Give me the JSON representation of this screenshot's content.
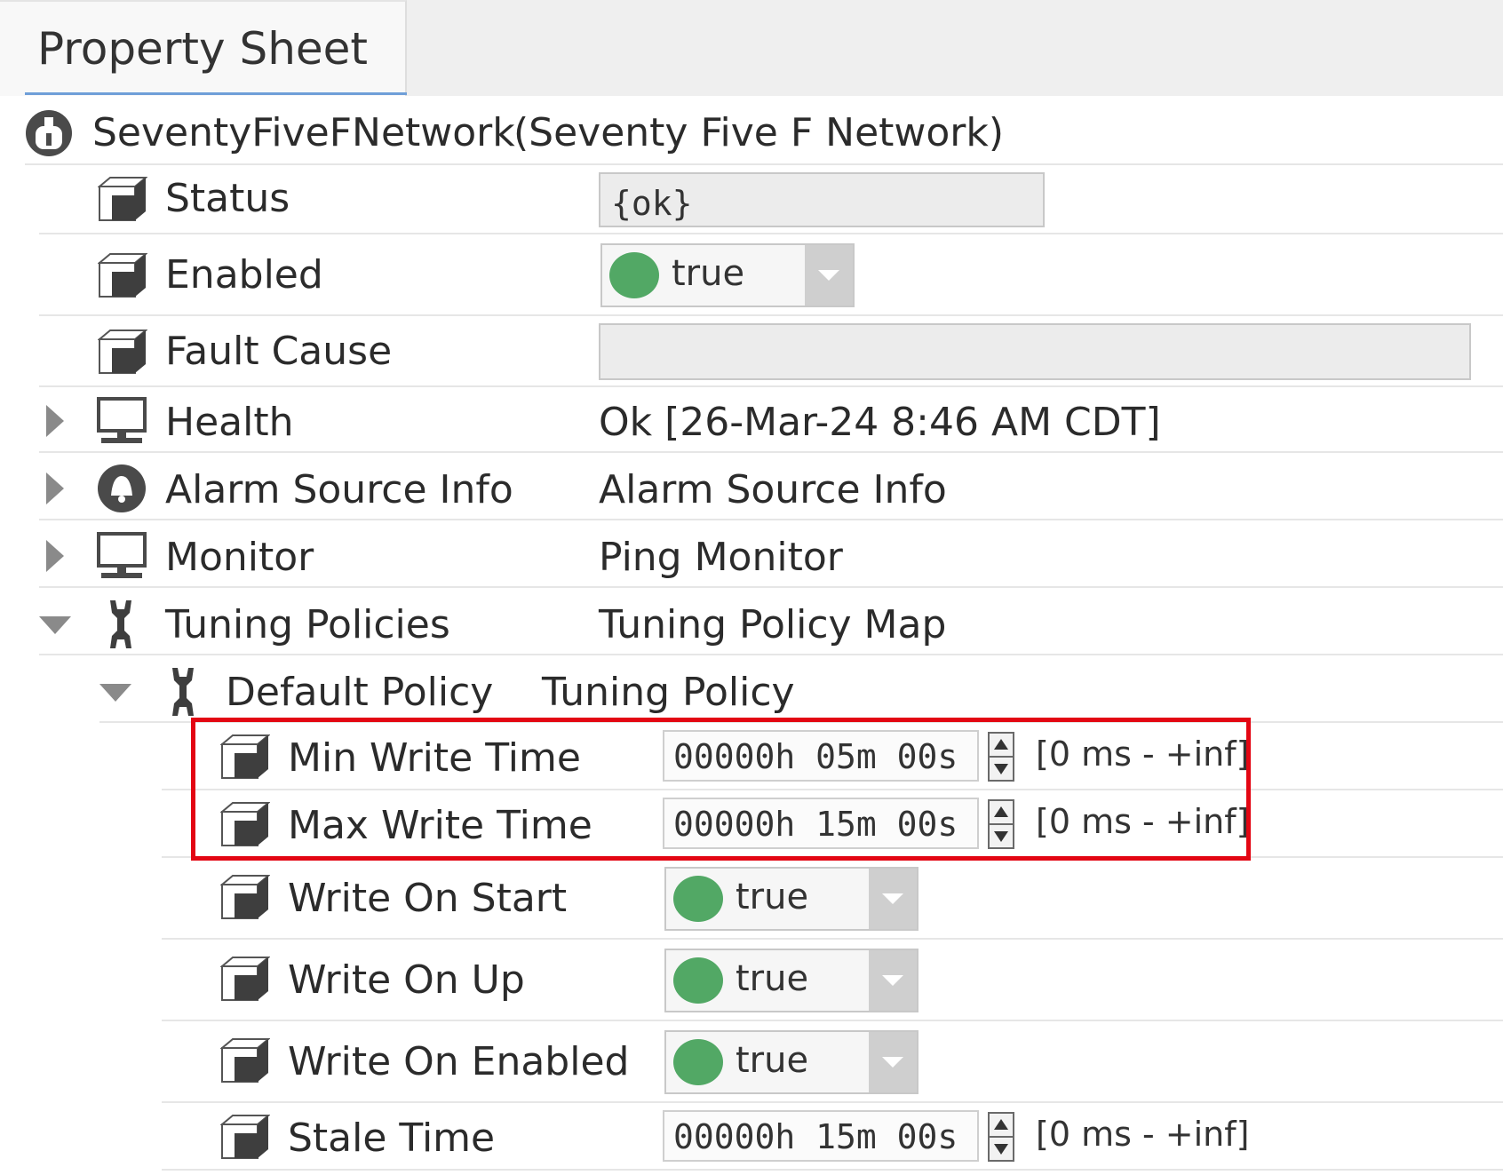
{
  "tab": {
    "title": "Property Sheet"
  },
  "network": {
    "name": "SeventyFiveFNetwork",
    "display": "(Seventy Five F Network)"
  },
  "properties": {
    "status": {
      "label": "Status",
      "value": "{ok}"
    },
    "enabled": {
      "label": "Enabled",
      "value": "true"
    },
    "fault_cause": {
      "label": "Fault Cause",
      "value": ""
    },
    "health": {
      "label": "Health",
      "value": "Ok [26-Mar-24 8:46 AM CDT]"
    },
    "alarm_source_info": {
      "label": "Alarm Source Info",
      "value": "Alarm Source Info"
    },
    "monitor": {
      "label": "Monitor",
      "value": "Ping Monitor"
    },
    "tuning_policies": {
      "label": "Tuning Policies",
      "value": "Tuning Policy Map"
    }
  },
  "default_policy": {
    "label": "Default Policy",
    "type": "Tuning Policy",
    "min_write_time": {
      "label": "Min Write Time",
      "value": "00000h 05m 00s",
      "range": "[0 ms - +inf]"
    },
    "max_write_time": {
      "label": "Max Write Time",
      "value": "00000h 15m 00s",
      "range": "[0 ms - +inf]"
    },
    "write_on_start": {
      "label": "Write On Start",
      "value": "true"
    },
    "write_on_up": {
      "label": "Write On Up",
      "value": "true"
    },
    "write_on_enabled": {
      "label": "Write On Enabled",
      "value": "true"
    },
    "stale_time": {
      "label": "Stale Time",
      "value": "00000h 15m 00s",
      "range": "[0 ms - +inf]"
    }
  },
  "colors": {
    "highlight": "#e30613",
    "true_dot": "#52a865",
    "tab_underline": "#6f9fd8"
  },
  "icons": {
    "network": "network-icon",
    "property": "property-cube-icon",
    "health": "monitor-icon",
    "alarm": "alarm-bell-icon",
    "tuning": "wrench-icon"
  }
}
